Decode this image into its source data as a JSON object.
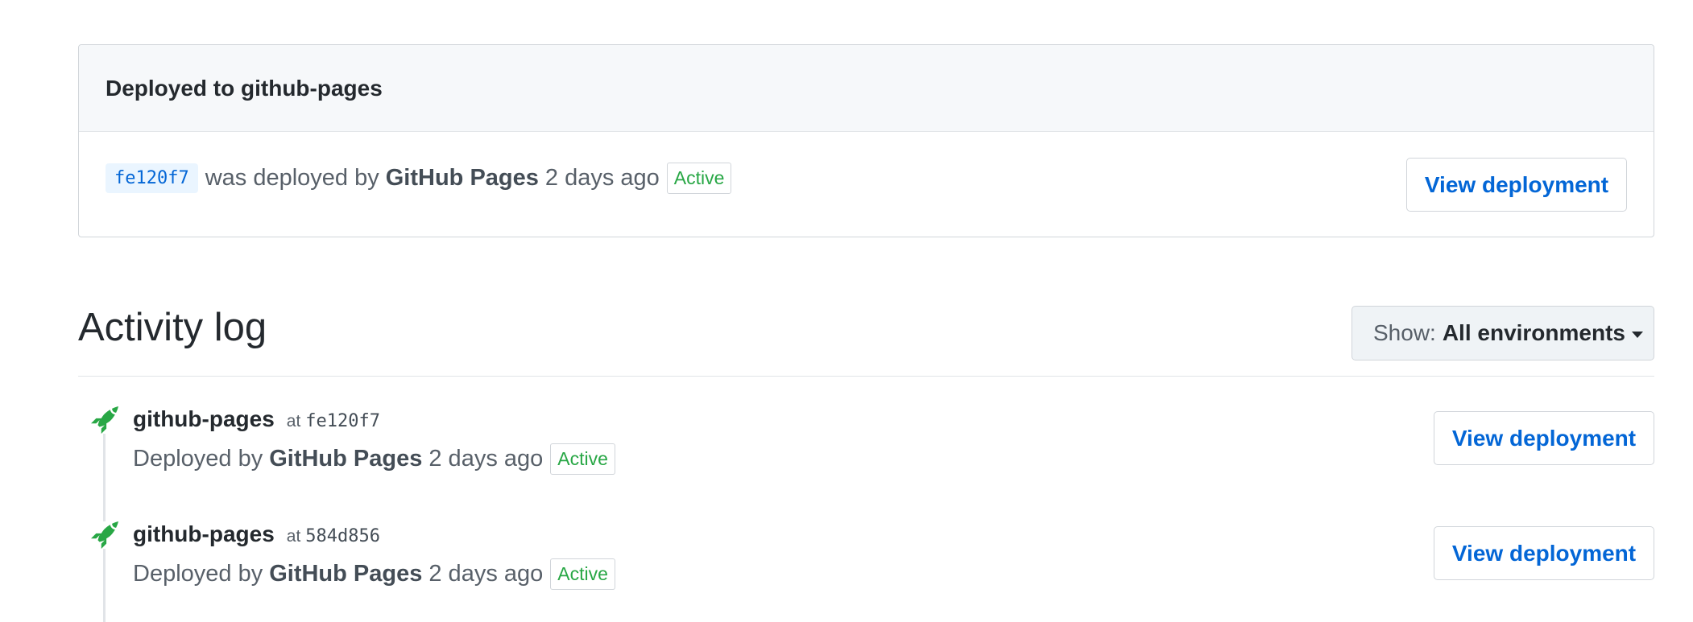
{
  "deployment_card": {
    "title": "Deployed to github-pages",
    "sha": "fe120f7",
    "deployed_by_text": "was deployed by",
    "deployer": "GitHub Pages",
    "time": "2 days ago",
    "status": "Active",
    "button_label": "View deployment"
  },
  "activity_log": {
    "title": "Activity log",
    "filter": {
      "label": "Show:",
      "value": "All environments"
    },
    "items": [
      {
        "icon": "rocket-icon",
        "environment": "github-pages",
        "at_label": "at",
        "sha": "fe120f7",
        "deployed_by_text": "Deployed by",
        "deployer": "GitHub Pages",
        "time": "2 days ago",
        "status": "Active",
        "button_label": "View deployment"
      },
      {
        "icon": "rocket-icon",
        "environment": "github-pages",
        "at_label": "at",
        "sha": "584d856",
        "deployed_by_text": "Deployed by",
        "deployer": "GitHub Pages",
        "time": "2 days ago",
        "status": "Active",
        "button_label": "View deployment"
      }
    ]
  },
  "colors": {
    "link_blue": "#0366d6",
    "success_green": "#28a745",
    "header_bg": "#f6f8fa",
    "border": "#d1d5da"
  }
}
